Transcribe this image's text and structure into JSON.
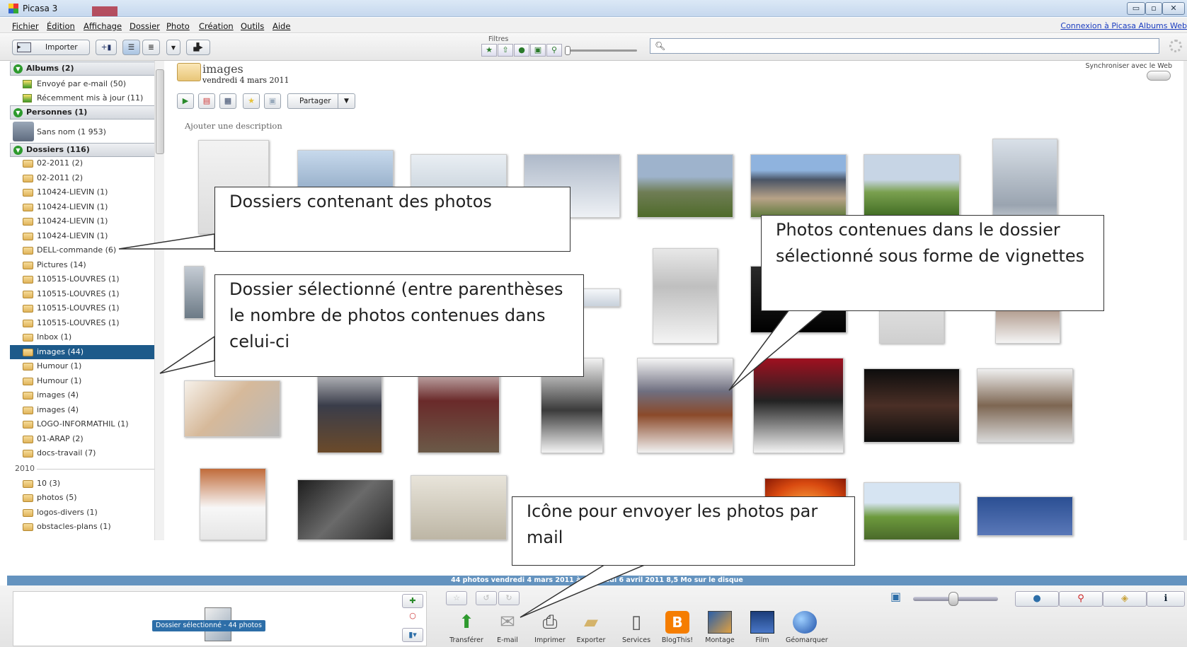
{
  "window": {
    "title": "Picasa 3",
    "controls": [
      "▭",
      "▫",
      "✕"
    ]
  },
  "menu": {
    "items": [
      "Fichier",
      "Édition",
      "Affichage",
      "Dossier",
      "Photo",
      "Création",
      "Outils",
      "Aide"
    ],
    "connect_link": "Connexion à Picasa Albums Web"
  },
  "toolbar": {
    "import_label": "Importer",
    "filters_label": "Filtres"
  },
  "sidebar": {
    "albums_header": "Albums (2)",
    "albums": [
      "Envoyé par e-mail (50)",
      "Récemment mis à jour (11)"
    ],
    "people_header": "Personnes (1)",
    "people": [
      "Sans nom (1 953)"
    ],
    "folders_header": "Dossiers (116)",
    "folders": [
      "02-2011 (2)",
      "02-2011 (2)",
      "110424-LIEVIN (1)",
      "110424-LIEVIN (1)",
      "110424-LIEVIN (1)",
      "110424-LIEVIN (1)",
      "DELL-commande (6)",
      "Pictures (14)",
      "110515-LOUVRES (1)",
      "110515-LOUVRES (1)",
      "110515-LOUVRES (1)",
      "110515-LOUVRES (1)",
      "Inbox (1)",
      "images (44)",
      "Humour (1)",
      "Humour (1)",
      "images (4)",
      "images (4)",
      "LOGO-INFORMATHIL (1)",
      "01-ARAP (2)",
      "docs-travail (7)"
    ],
    "selected_index": 13,
    "year_2010": "2010",
    "folders_2010": [
      "10 (3)",
      "photos (5)",
      "logos-divers (1)",
      "obstacles-plans (1)"
    ]
  },
  "main": {
    "folder_name": "images",
    "folder_date": "vendredi 4 mars 2011",
    "sync_label": "Synchroniser avec le Web",
    "share_button": "Partager",
    "add_description": "Ajouter une description"
  },
  "status": {
    "text": "44 photos   vendredi 4 mars 2011 à vendredi 6 avril 2011   8,5 Mo sur le disque"
  },
  "tray": {
    "label": "Dossier sélectionné - 44 photos"
  },
  "actions": [
    "Transférer",
    "E-mail",
    "Imprimer",
    "Exporter",
    "Services",
    "BlogThis!",
    "Montage",
    "Film",
    "Géomarquer"
  ],
  "callouts": {
    "folders": "Dossiers contenant des photos",
    "selected": "Dossier sélectionné (entre parenthèses le nombre de photos contenues dans celui-ci",
    "thumbnails": "Photos contenues dans le dossier sélectionné sous forme de vignettes",
    "email": "Icône pour envoyer les photos par mail"
  },
  "colors": {
    "selection": "#1d5a8a",
    "status_bar": "#6493bf",
    "accent_green": "#2d9a2d"
  }
}
